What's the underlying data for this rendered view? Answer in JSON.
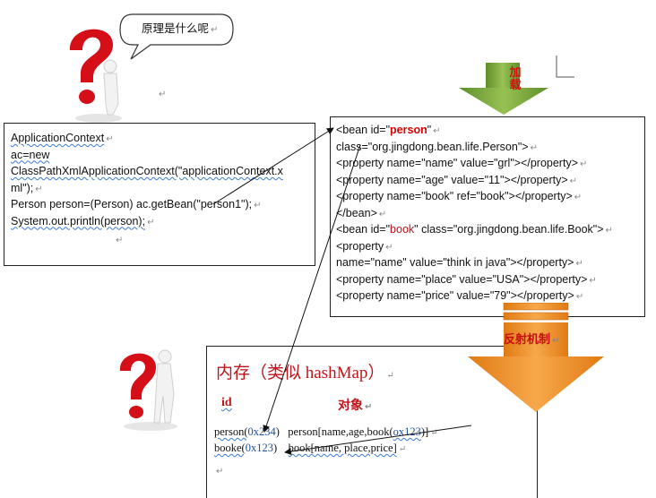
{
  "speech_bubble": {
    "text": "原理是什么呢",
    "mark": "↵"
  },
  "load_arrow": {
    "label_top": "加",
    "label_bottom": "载"
  },
  "reflection_arrow": {
    "label": "反射机制",
    "mark": "↵"
  },
  "java_code": {
    "lines": [
      {
        "text": "ApplicationContext",
        "mark": "↵"
      },
      {
        "text": "ac=new",
        "mark": ""
      },
      {
        "text": "ClassPathXmlApplicationContext(\"applicationContext.x",
        "mark": ""
      },
      {
        "text": "ml\");",
        "mark": "↵"
      },
      {
        "text": "Person person=(Person) ac.getBean(\"person1\");",
        "mark": "↵"
      },
      {
        "text": "System.out.println(person);",
        "mark": "↵"
      }
    ],
    "trailing_mark": "↵"
  },
  "xml_code": {
    "bean1_open_prefix": "<bean id=\"",
    "bean1_id": "person",
    "bean1_open_suffix": "\"",
    "lines": [
      "class=\"org.jingdong.bean.life.Person\">",
      "<property name=\"name\" value=\"grl\"></property>",
      "<property name=\"age\" value=\"11\"></property>",
      "<property name=\"book\"  ref=\"book\"></property>",
      "</bean>"
    ],
    "bean2_prefix": "<bean id=\"",
    "bean2_id": "book",
    "bean2_suffix": "\" class=\"org.jingdong.bean.life.Book\">",
    "lines2": [
      "<property",
      "name=\"name\" value=\"think in java\"></property>",
      "<property name=\"place\" value=\"USA\"></property>",
      "<property name=\"price\" value=\"79\"></property>"
    ],
    "mark": "↵"
  },
  "memory": {
    "title": "内存（类似 hashMap）",
    "col_id": "id",
    "col_obj": "对象",
    "row1_id_prefix": "person(",
    "row1_id_addr": "0x234",
    "row1_id_suffix": ")",
    "row1_obj_prefix": "person[name,age,book(",
    "row1_obj_addr": "ox123",
    "row1_obj_suffix": ")]",
    "row2_id_prefix": "booke(",
    "row2_id_addr": "0x123",
    "row2_id_suffix": ")",
    "row2_obj": "book[name, place,price]",
    "mark": "↵"
  },
  "stray_mark": "↵",
  "colors": {
    "accent_red": "#d00000",
    "arrow_green": "#7aa33a",
    "arrow_orange": "#f2952f",
    "address_blue": "#1f4e9c"
  }
}
